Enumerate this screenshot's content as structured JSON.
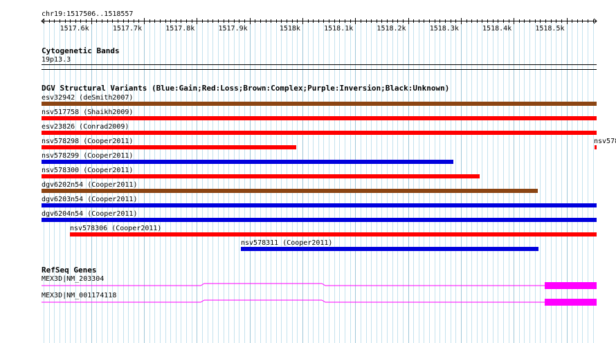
{
  "ruler": {
    "position": "chr19:1517506..1518557",
    "start": 1517506,
    "end": 1518557,
    "ticks": [
      {
        "pos": 1517600,
        "label": "1517.6k"
      },
      {
        "pos": 1517700,
        "label": "1517.7k"
      },
      {
        "pos": 1517800,
        "label": "1517.8k"
      },
      {
        "pos": 1517900,
        "label": "1517.9k"
      },
      {
        "pos": 1518000,
        "label": "1518k"
      },
      {
        "pos": 1518100,
        "label": "1518.1k"
      },
      {
        "pos": 1518200,
        "label": "1518.2k"
      },
      {
        "pos": 1518300,
        "label": "1518.3k"
      },
      {
        "pos": 1518400,
        "label": "1518.4k"
      },
      {
        "pos": 1518500,
        "label": "1518.5k"
      }
    ]
  },
  "cytoband": {
    "title": "Cytogenetic Bands",
    "band": "19p13.3"
  },
  "dgv": {
    "title": "DGV Structural Variants (Blue:Gain;Red:Loss;Brown:Complex;Purple:Inversion;Black:Unknown)",
    "colors": {
      "gain": "#0000dd",
      "loss": "#ff0000",
      "complex": "#8b4513"
    },
    "variants": [
      {
        "label": "esv32942 (deSmith2007)",
        "type": "complex",
        "start": 1517506,
        "end": 1518557
      },
      {
        "label": "nsv517758 (Shaikh2009)",
        "type": "loss",
        "start": 1517506,
        "end": 1518557
      },
      {
        "label": "esv23826 (Conrad2009)",
        "type": "loss",
        "start": 1517506,
        "end": 1518557
      },
      {
        "label": "nsv578298 (Cooper2011)",
        "type": "loss",
        "start": 1517506,
        "end": 1517988
      },
      {
        "label": "nsv578299 (Cooper2011)",
        "type": "gain",
        "start": 1517506,
        "end": 1518286
      },
      {
        "label": "nsv578300 (Cooper2011)",
        "type": "loss",
        "start": 1517506,
        "end": 1518335
      },
      {
        "label": "dgv6202n54 (Cooper2011)",
        "type": "complex",
        "start": 1517506,
        "end": 1518446
      },
      {
        "label": "dgv6203n54 (Cooper2011)",
        "type": "gain",
        "start": 1517506,
        "end": 1518557
      },
      {
        "label": "dgv6204n54 (Cooper2011)",
        "type": "gain",
        "start": 1517506,
        "end": 1518557
      },
      {
        "label": "nsv578306 (Cooper2011)",
        "type": "loss",
        "start": 1517560,
        "end": 1518557
      },
      {
        "label": "nsv578311 (Cooper2011)",
        "type": "gain",
        "start": 1517883,
        "end": 1518446
      }
    ],
    "offscreen": {
      "label": "nsv578",
      "type": "loss",
      "start": 1518556,
      "end": 1518557
    }
  },
  "refseq": {
    "title": "RefSeq Genes",
    "color": "#ff00ff",
    "genes": [
      {
        "label": "MEX3D|NM_203304",
        "exon_start": 1518459,
        "exon_end": 1518557
      },
      {
        "label": "MEX3D|NM_001174118",
        "exon_start": 1518459,
        "exon_end": 1518557
      }
    ]
  }
}
